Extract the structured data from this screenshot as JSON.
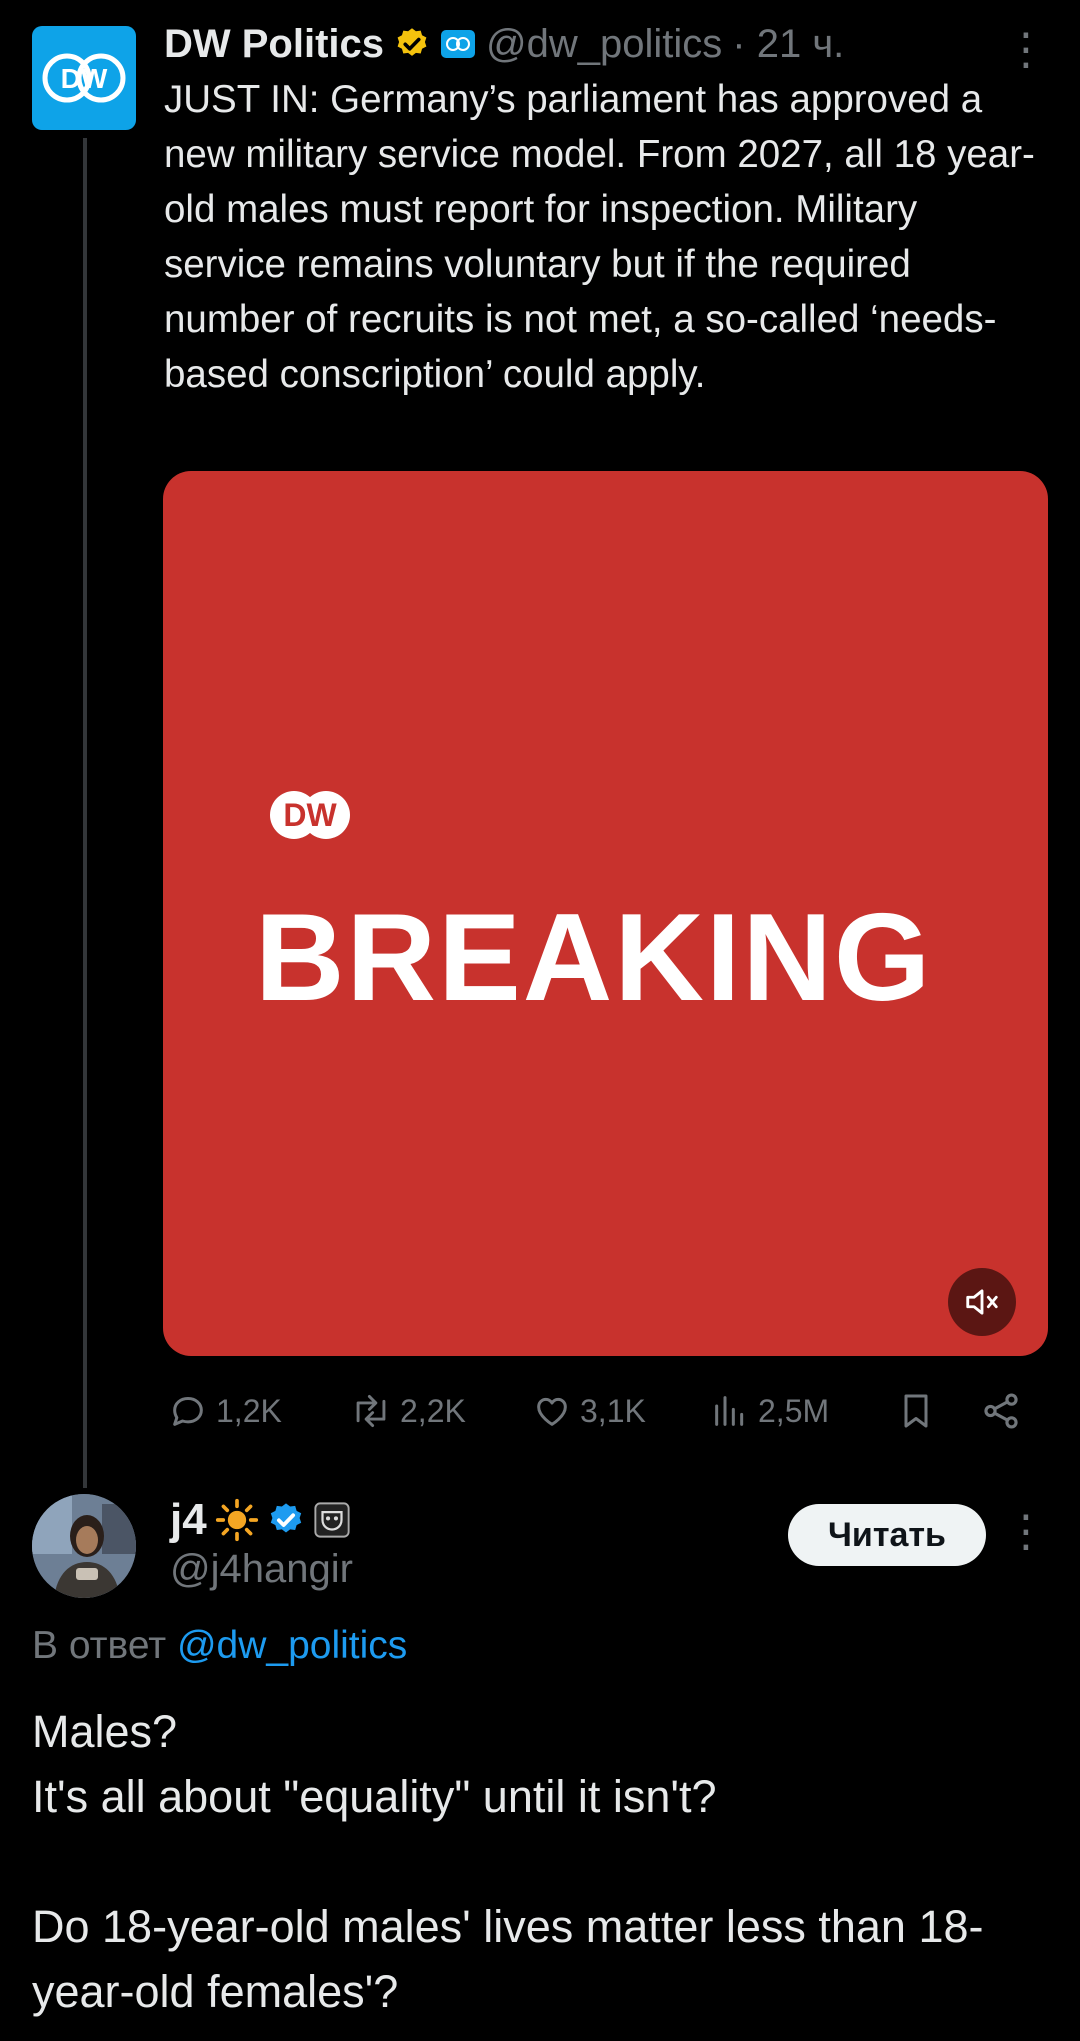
{
  "tweet": {
    "author_name": "DW Politics",
    "handle": "@dw_politics",
    "time": "· 21 ч.",
    "text": "JUST IN: Germany’s parliament has approved a new military service model. From 2027, all 18 year-old males must report for inspection. Military service remains voluntary but if the required number of recruits is not met, a so-called ‘needs-based conscription’ could apply.",
    "avatar_logo": "DW",
    "media": {
      "logo": "DW",
      "headline": "BREAKING",
      "background": "#c8322d"
    },
    "stats": {
      "replies": "1,2K",
      "reposts": "2,2K",
      "likes": "3,1K",
      "views": "2,5M"
    }
  },
  "reply": {
    "author_name": "j4",
    "handle": "@j4hangir",
    "follow_label": "Читать",
    "reply_prefix": "В ответ",
    "reply_mention": "@dw_politics",
    "text": "Males?\nIt's all about \"equality\" until it isn't?\n\nDo 18-year-old males' lives matter less than 18-year-old females'?"
  },
  "colors": {
    "accent": "#1d9bf0",
    "verified_gold": "#f4c20d",
    "muted": "#71767b",
    "dw_blue": "#0ea3e8"
  }
}
